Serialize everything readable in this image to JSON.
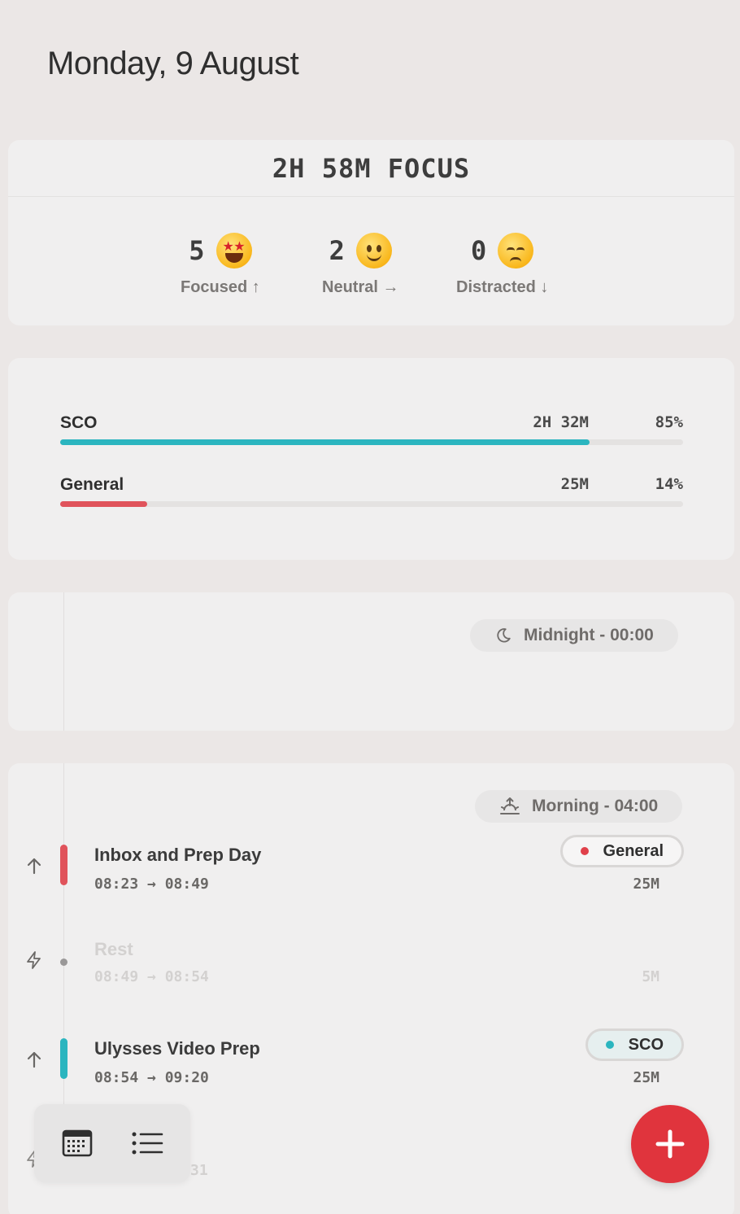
{
  "header": {
    "date": "Monday, 9 August"
  },
  "summary": {
    "total_focus": "2H 58M FOCUS",
    "moods": [
      {
        "count": "5",
        "label": "Focused ↑",
        "icon": "star-struck-emoji"
      },
      {
        "count": "2",
        "label": "Neutral →",
        "icon": "smiling-face-emoji"
      },
      {
        "count": "0",
        "label": "Distracted ↓",
        "icon": "pensive-face-emoji"
      }
    ]
  },
  "projects": [
    {
      "name": "SCO",
      "duration": "2H 32M",
      "percent": "85%",
      "fraction": 0.85,
      "color": "#2bb5bf"
    },
    {
      "name": "General",
      "duration": "25M",
      "percent": "14%",
      "fraction": 0.14,
      "color": "#e0535b"
    }
  ],
  "timeline": {
    "midnight": {
      "label": "Midnight - 00:00",
      "icon": "moon-icon"
    },
    "morning": {
      "label": "Morning - 04:00",
      "icon": "sunrise-icon",
      "entries": [
        {
          "title": "Inbox and Prep Day",
          "times": "08:23 → 08:49",
          "tag": "General",
          "tag_color": "#e0404a",
          "length": "25M",
          "direction": "up-arrow-icon",
          "bar_color": "#e0535b"
        },
        {
          "title": "Rest",
          "times": "08:49 → 08:54",
          "length": "5M",
          "direction": "lightning-icon"
        },
        {
          "title": "Ulysses Video Prep",
          "times": "08:54 → 09:20",
          "tag": "SCO",
          "tag_color": "#2bb5bf",
          "length": "25M",
          "direction": "up-arrow-icon",
          "bar_color": "#2bb5bf"
        },
        {
          "times_partial": "31"
        }
      ]
    }
  },
  "toolbar": {
    "calendar_icon": "calendar-icon",
    "list_icon": "list-icon"
  },
  "fab": {
    "icon": "plus-icon"
  }
}
